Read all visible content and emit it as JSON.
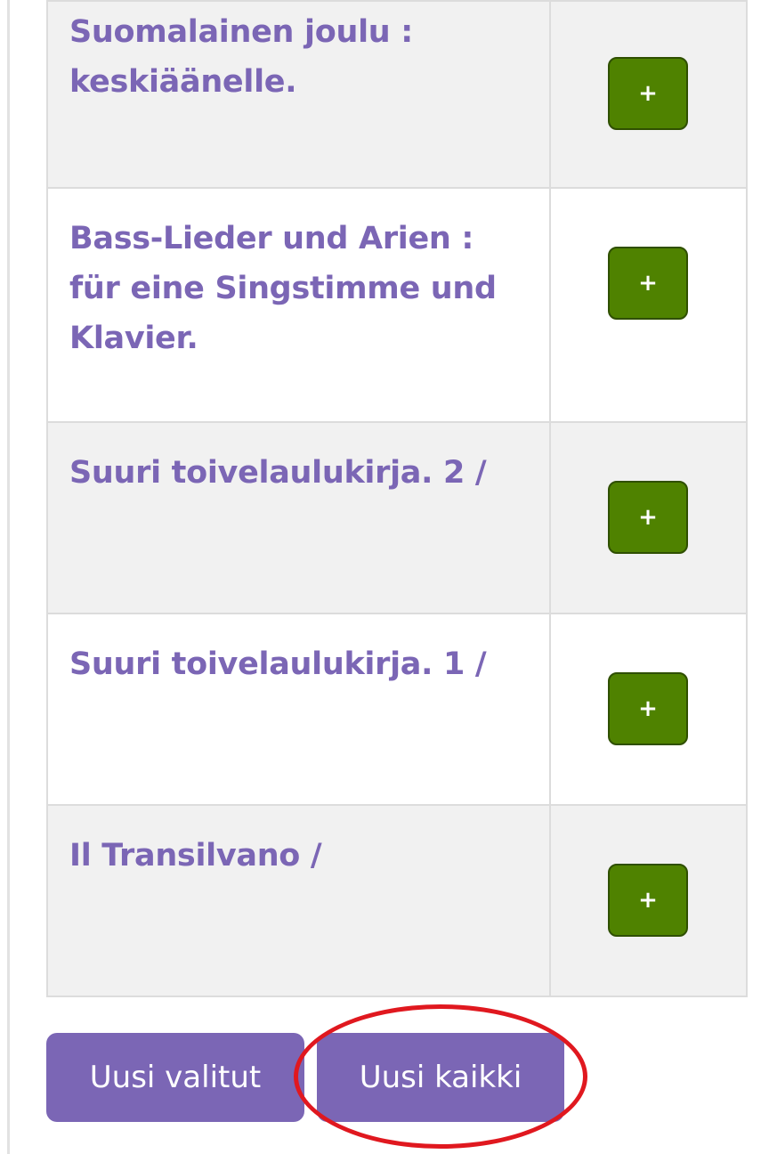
{
  "results": [
    {
      "title": "Suomalainen joulu : keskiäänelle.",
      "add_label": "+"
    },
    {
      "title": "Bass-Lieder und Arien : für eine Singstimme und Klavier.",
      "add_label": "+"
    },
    {
      "title": "Suuri toivelaulukirja. 2 /",
      "add_label": "+"
    },
    {
      "title": "Suuri toivelaulukirja. 1 /",
      "add_label": "+"
    },
    {
      "title": "Il Transilvano /",
      "add_label": "+"
    }
  ],
  "actions": {
    "renew_selected_label": "Uusi valitut",
    "renew_all_label": "Uusi kaikki"
  },
  "colors": {
    "accent": "#7b66b5",
    "add_button": "#4f8200",
    "highlight": "#e0181f"
  }
}
